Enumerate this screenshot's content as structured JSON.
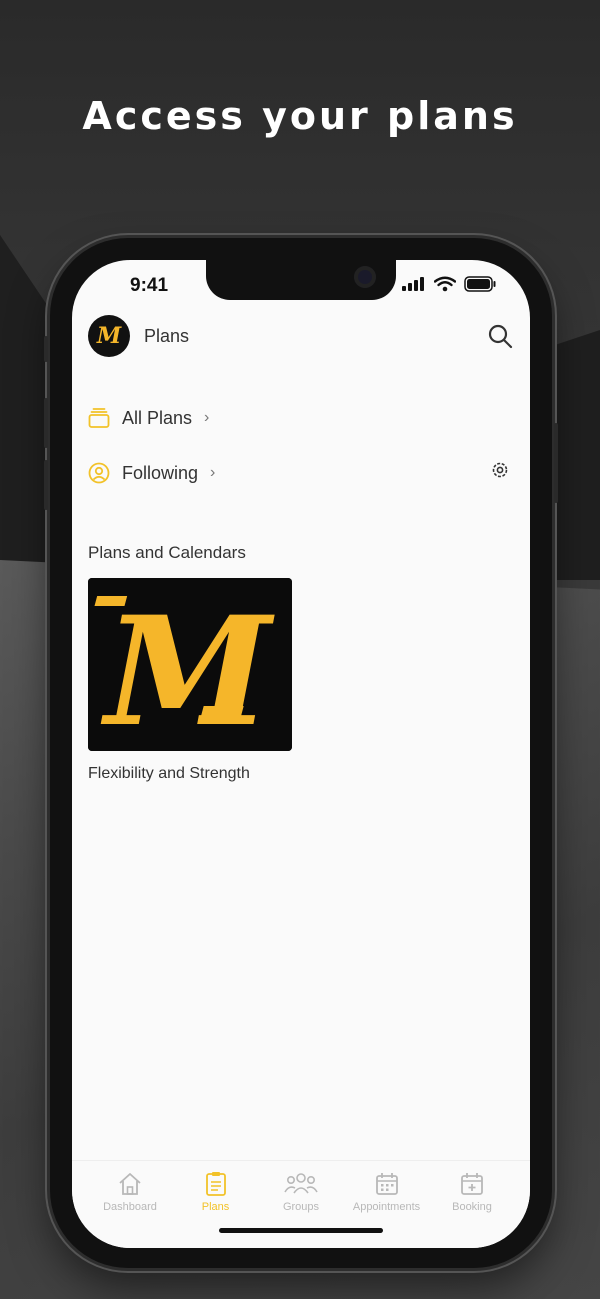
{
  "promo": {
    "headline": "Access your plans"
  },
  "status_bar": {
    "time": "9:41"
  },
  "header": {
    "title": "Plans",
    "avatar_letter": "M"
  },
  "nav": {
    "all_plans": "All Plans",
    "following": "Following"
  },
  "section": {
    "title": "Plans and Calendars"
  },
  "plans": [
    {
      "name": "Flexibility and Strength",
      "logo_letter": "M"
    }
  ],
  "tabbar": [
    {
      "label": "Dashboard",
      "icon": "home-icon",
      "active": false
    },
    {
      "label": "Plans",
      "icon": "clipboard-icon",
      "active": true
    },
    {
      "label": "Groups",
      "icon": "group-icon",
      "active": false
    },
    {
      "label": "Appointments",
      "icon": "calendar-icon",
      "active": false
    },
    {
      "label": "Booking",
      "icon": "calendar-plus-icon",
      "active": false
    }
  ],
  "colors": {
    "accent": "#f2c229",
    "logo_gold": "#f5b62a",
    "text": "#333333"
  }
}
